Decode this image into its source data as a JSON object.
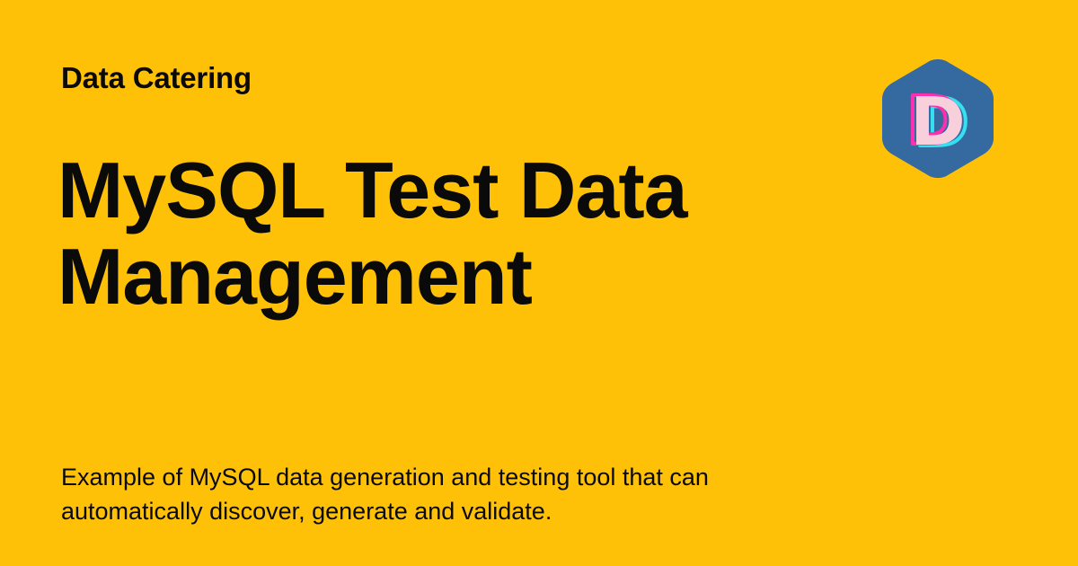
{
  "header": {
    "site_name": "Data Catering"
  },
  "main": {
    "title": "MySQL Test Data Management",
    "description": "Example of MySQL data generation and testing tool that can automatically discover, generate and validate."
  },
  "logo": {
    "icon": "data-catering-logo-icon",
    "letter": "D"
  },
  "colors": {
    "background": "#FFC107",
    "text": "#0A0A0A",
    "logo_hexagon": "#356AA0",
    "logo_letter": "#F8D0DC",
    "logo_letter_outline_pink": "#FF2FB0",
    "logo_letter_outline_cyan": "#35E0F0"
  }
}
